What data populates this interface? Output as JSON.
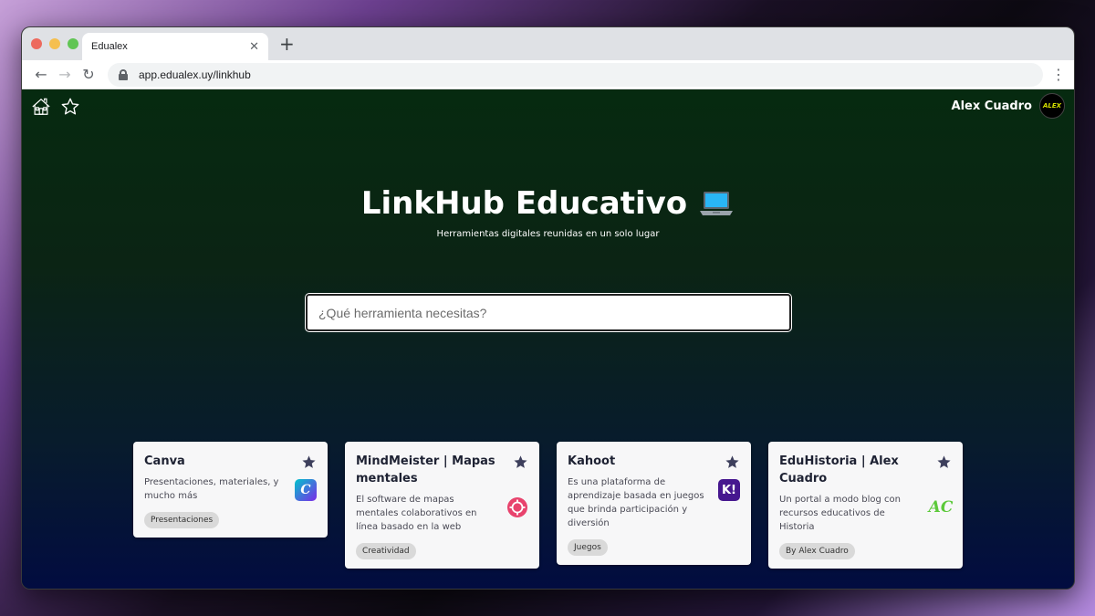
{
  "browser": {
    "tab_title": "Edualex",
    "close_glyph": "✕",
    "new_tab_glyph": "+",
    "url": "app.edualex.uy/linkhub",
    "back_glyph": "←",
    "forward_glyph": "→",
    "reload_glyph": "↻",
    "menu_glyph": "⋮"
  },
  "header": {
    "user_name": "Alex Cuadro",
    "avatar_text": "ALEX"
  },
  "hero": {
    "title": "LinkHub Educativo",
    "subtitle": "Herramientas digitales reunidas en un solo lugar"
  },
  "search": {
    "placeholder": "¿Qué herramienta necesitas?",
    "value": ""
  },
  "cards": [
    {
      "title": "Canva",
      "description": "Presentaciones, materiales, y mucho más",
      "tag": "Presentaciones",
      "logo_text": "C",
      "icon": "canva-logo-icon"
    },
    {
      "title": "MindMeister | Mapas mentales",
      "description": "El software de mapas mentales colaborativos en línea basado en la web",
      "tag": "Creatividad",
      "logo_text": "",
      "icon": "mindmeister-logo-icon"
    },
    {
      "title": "Kahoot",
      "description": "Es una plataforma de aprendizaje basada en juegos que brinda participación y diversión",
      "tag": "Juegos",
      "logo_text": "K!",
      "icon": "kahoot-logo-icon"
    },
    {
      "title": "EduHistoria | Alex Cuadro",
      "description": "Un portal a modo blog con recursos educativos de Historia",
      "tag": "By Alex Cuadro",
      "logo_text": "AC",
      "icon": "eduhistoria-logo-icon"
    }
  ],
  "colors": {
    "card_title": "#1e2233",
    "star": "#3d3f5c",
    "kahoot": "#46178f",
    "eduhistoria": "#5cc93a",
    "mindmeister": "#e8436d"
  }
}
